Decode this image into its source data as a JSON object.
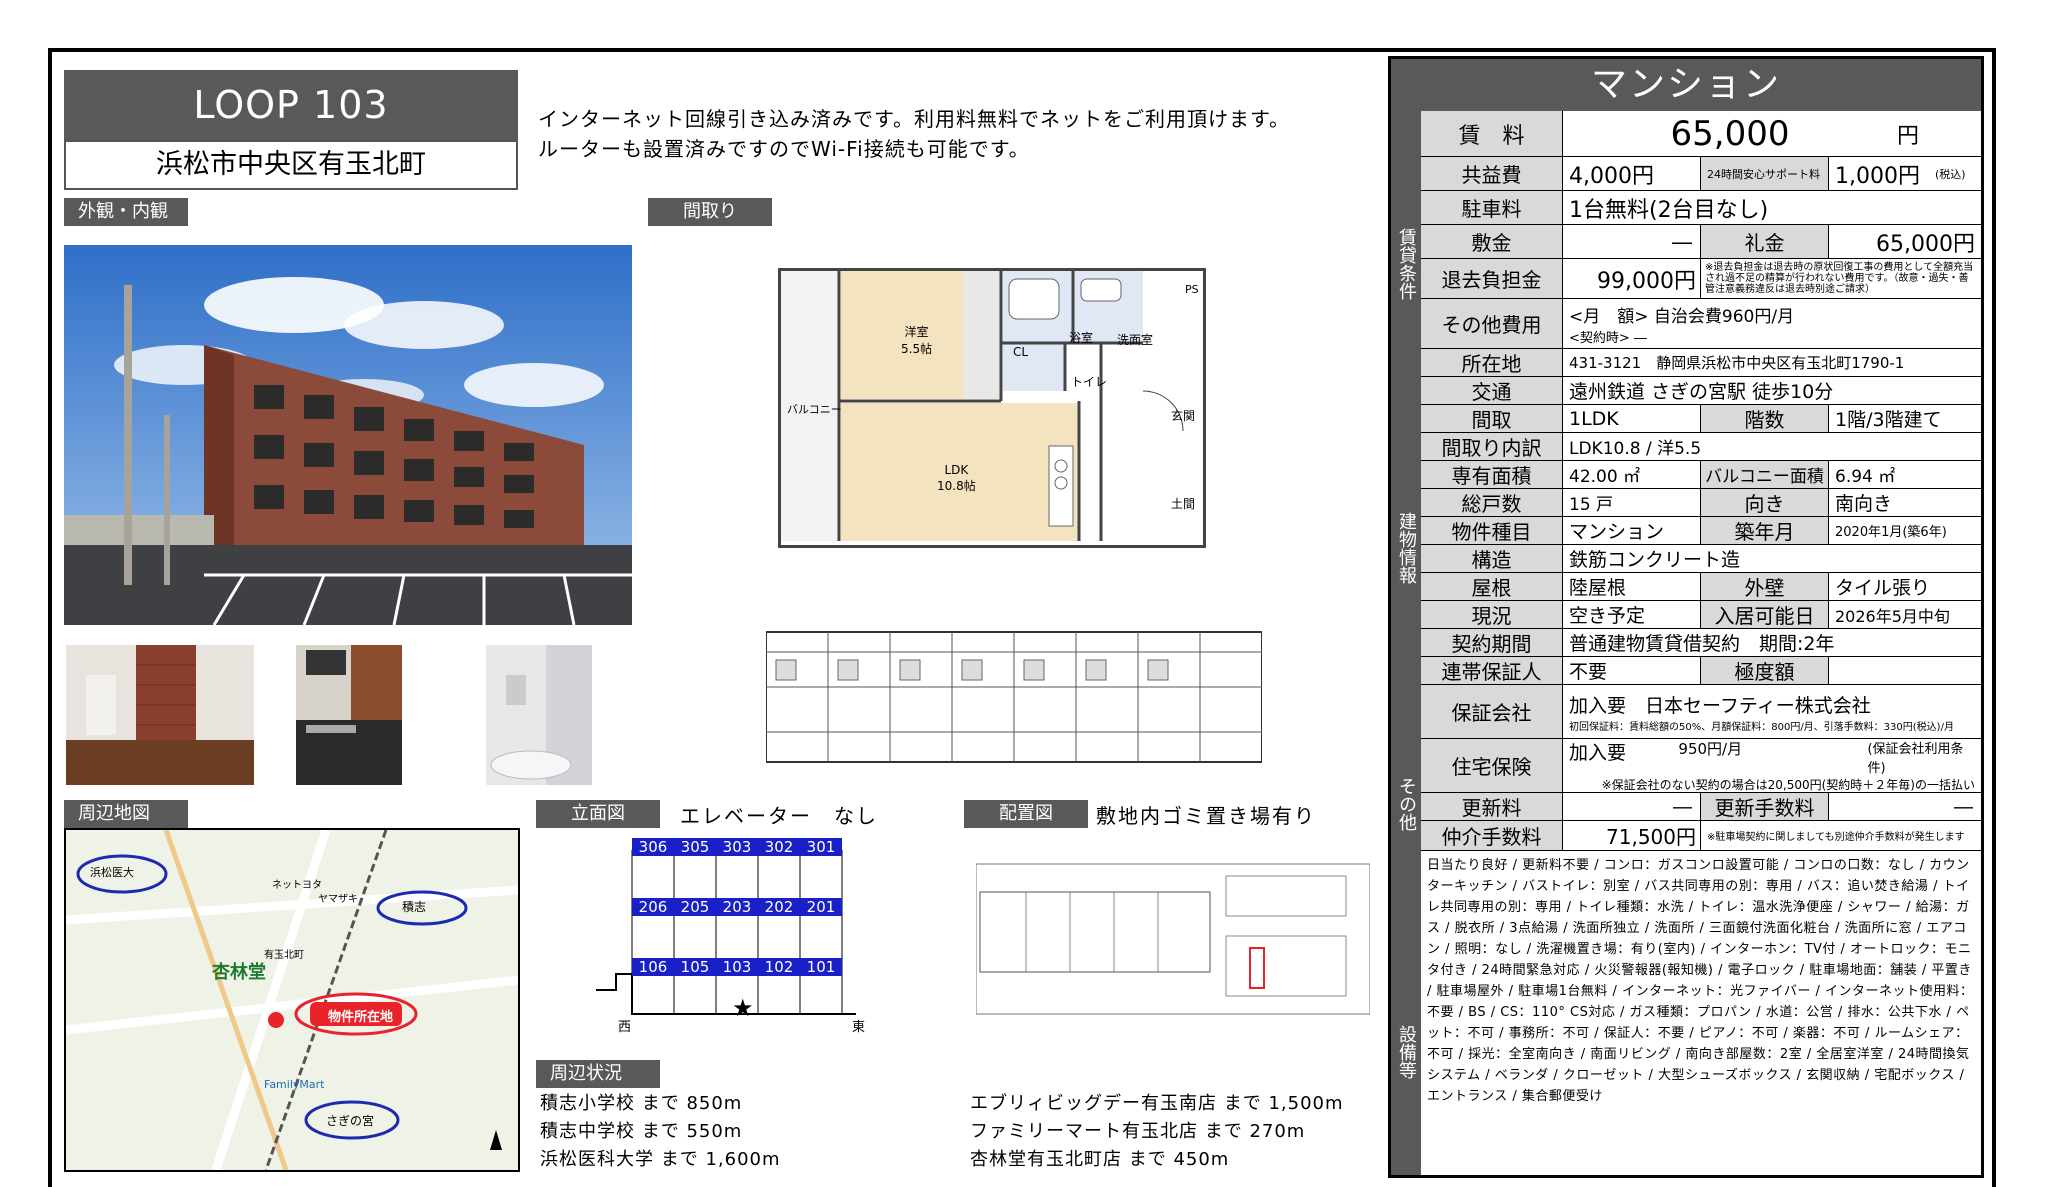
{
  "header": {
    "property_name": "LOOP 103",
    "address_short": "浜松市中央区有玉北町",
    "description_line1": "インターネット回線引き込み済みです。利用料無料でネットをご利用頂けます。",
    "description_line2": "ルーターも設置済みですのでWi-Fi接続も可能です。"
  },
  "sections": {
    "exterior": "外観・内観",
    "floorplan": "間取り",
    "area_map": "周辺地図",
    "elevation": "立面図",
    "elevator": "エレベーター　なし",
    "layout": "配置図",
    "garbage": "敷地内ゴミ置き場有り",
    "surroundings": "周辺状況"
  },
  "floorplan_labels": {
    "western": "洋室",
    "western_size": "5.5帖",
    "cl": "CL",
    "bath": "浴室",
    "wash": "洗面室",
    "ps": "PS",
    "toilet": "トイレ",
    "entrance": "玄関",
    "ldk": "LDK",
    "ldk_size": "10.8帖",
    "balcony": "バルコニー",
    "doma": "土間"
  },
  "elevation": {
    "rows": [
      [
        "306",
        "305",
        "303",
        "302",
        "301"
      ],
      [
        "206",
        "205",
        "203",
        "202",
        "201"
      ],
      [
        "106",
        "105",
        "103",
        "102",
        "101"
      ]
    ],
    "west": "西",
    "east": "東",
    "star": "★"
  },
  "map_labels": {
    "med": "浜松医大",
    "tsukishi": "積志",
    "kyorindo": "杏林堂",
    "property": "物件所在地",
    "sagino": "さぎの宮",
    "netto": "ネットヨタ",
    "yamaha": "ヤマザキ",
    "family": "FamilyMart",
    "arita": "有玉北町"
  },
  "nearby_left": [
    "積志小学校 まで 850m",
    "積志中学校 まで 550m",
    "浜松医科大学 まで 1,600m"
  ],
  "nearby_right": [
    "エブリィビッグデー有玉南店 まで 1,500m",
    "ファミリーマート有玉北店 まで 270m",
    "杏林堂有玉北町店 まで 450m"
  ],
  "panel": {
    "type": "マンション",
    "side_rent": "賃貸条件",
    "side_building": "建物情報",
    "side_other": "その他",
    "side_equip": "設備等",
    "rent_label": "賃　料",
    "rent_value": "65,000",
    "rent_unit": "円",
    "common_label": "共益費",
    "common_value": "4,000円",
    "support_label": "24時間安心サポート料",
    "support_value": "1,000円",
    "support_tax": "(税込)",
    "parking_label": "駐車料",
    "parking_value": "1台無料(2台目なし)",
    "deposit_label": "敷金",
    "deposit_value": "―",
    "key_label": "礼金",
    "key_value": "65,000円",
    "moveout_label": "退去負担金",
    "moveout_value": "99,000円",
    "moveout_note": "※退去負担金は退去時の原状回復工事の費用として全額充当され過不足の精算が行われない費用です。（故意・過失・善管注意義務違反は退去時別途ご請求）",
    "other_label": "その他費用",
    "other_monthly": "<月　額> 自治会費960円/月",
    "other_contract": "<契約時> ―",
    "location_label": "所在地",
    "location_value": "431-3121　静岡県浜松市中央区有玉北町1790-1",
    "traffic_label": "交通",
    "traffic_value": "遠州鉄道 さぎの宮駅 徒歩10分",
    "madori_label": "間取",
    "madori_value": "1LDK",
    "floors_label": "階数",
    "floors_value": "1階/3階建て",
    "breakdown_label": "間取り内訳",
    "breakdown_value": "LDK10.8 / 洋5.5",
    "area_label": "専有面積",
    "area_value": "42.00 ㎡",
    "balcony_label": "バルコニー面積",
    "balcony_value": "6.94 ㎡",
    "units_label": "総戸数",
    "units_value": "15 戸",
    "direction_label": "向き",
    "direction_value": "南向き",
    "kind_label": "物件種目",
    "kind_value": "マンション",
    "built_label": "築年月",
    "built_value": "2020年1月(築6年)",
    "structure_label": "構造",
    "structure_value": "鉄筋コンクリート造",
    "roof_label": "屋根",
    "roof_value": "陸屋根",
    "wall_label": "外壁",
    "wall_value": "タイル張り",
    "status_label": "現況",
    "status_value": "空き予定",
    "movein_label": "入居可能日",
    "movein_value": "2026年5月中旬",
    "term_label": "契約期間",
    "term_value": "普通建物賃貸借契約　期間:2年",
    "guarantor_label": "連帯保証人",
    "guarantor_value": "不要",
    "limit_label": "極度額",
    "limit_value": "",
    "gcompany_label": "保証会社",
    "gcompany_value": "加入要　日本セーフティー株式会社",
    "gcompany_note": "初回保証料：賃料総額の50%、月額保証料：800円/月、引落手数料：330円(税込)/月",
    "insurance_label": "住宅保険",
    "insurance_value": "加入要",
    "insurance_price": "950円/月",
    "insurance_cond": "(保証会社利用条件)",
    "insurance_note": "※保証会社のない契約の場合は20,500円(契約時＋２年毎)の一括払い",
    "renew_label": "更新料",
    "renew_value": "―",
    "renew_fee_label": "更新手数料",
    "renew_fee_value": "―",
    "broker_label": "仲介手数料",
    "broker_value": "71,500円",
    "broker_note": "※駐車場契約に関しましても別途仲介手数料が発生します",
    "equipment": "日当たり良好 / 更新料不要 / コンロ：ガスコンロ設置可能 / コンロの口数：なし / カウンターキッチン / バストイレ：別室 / バス共同専用の別：専用 / バス：追い焚き給湯 / トイレ共同専用の別：専用 / トイレ種類：水洗 / トイレ：温水洗浄便座 / シャワー / 給湯：ガス / 脱衣所 / 3点給湯 / 洗面所独立 / 洗面所 / 三面鏡付洗面化粧台 / 洗面所に窓 / エアコン / 照明：なし / 洗濯機置き場：有り(室内) / インターホン：TV付 / オートロック：モニタ付き / 24時間緊急対応 / 火災警報器(報知機) / 電子ロック / 駐車場地面：舗装 / 平置き / 駐車場屋外 / 駐車場1台無料 / インターネット：光ファイバー / インターネット使用料：不要 / BS / CS：110° CS対応 / ガス種類：プロパン / 水道：公営 / 排水：公共下水 / ペット：不可 / 事務所：不可 / 保証人：不要 / ピアノ：不可 / 楽器：不可 / ルームシェア：不可 / 採光：全室南向き / 南面リビング / 南向き部屋数：2室 / 全居室洋室 / 24時間換気システム / ベランダ / クローゼット / 大型シューズボックス / 玄関収納 / 宅配ボックス / エントランス / 集合郵便受け"
  },
  "colors": {
    "header_gray": "#595959",
    "label_gray": "#d9d9d9",
    "unit_blue": "#1a20c8",
    "map_circle": "#1b2ab0",
    "property_red": "#e8232a"
  }
}
